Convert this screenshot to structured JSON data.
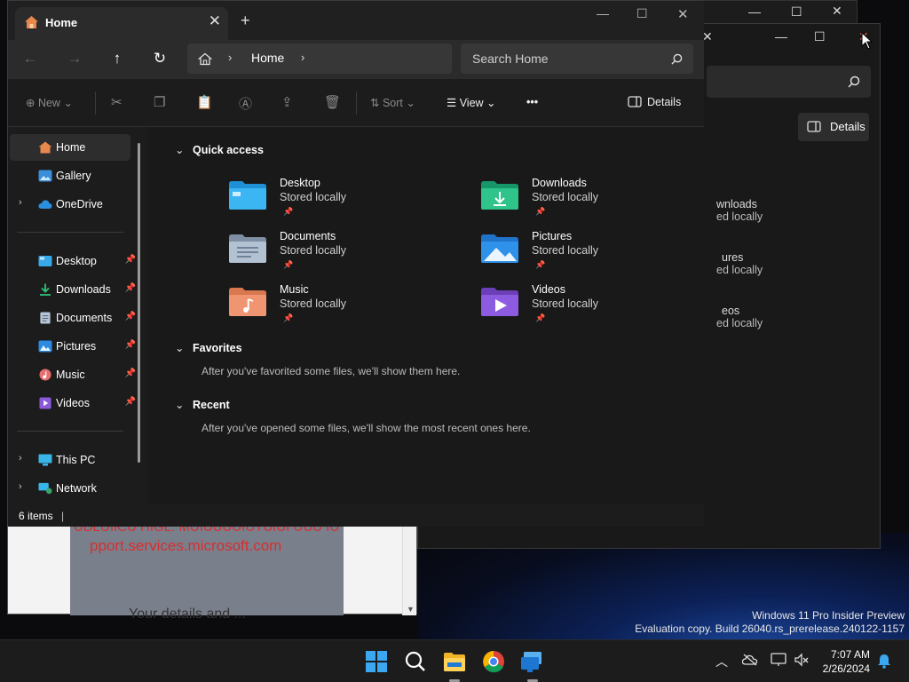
{
  "watermark": {
    "line1": "Windows 11 Pro Insider Preview",
    "line2": "Evaluation copy. Build 26040.rs_prerelease.240122-1157"
  },
  "back_browser": {
    "red_line1": "UDLUIICU HIGL. MUIUUUUIUTUIUI UUU IU",
    "red_line2": "pport.services.microsoft.com",
    "dark_text": "Your details and ..."
  },
  "win3": {
    "details_label": "Details",
    "items": [
      {
        "name": "wnloads",
        "sub": "ed locally"
      },
      {
        "name": "ures",
        "sub": "ed locally"
      },
      {
        "name": "eos",
        "sub": "ed locally"
      }
    ]
  },
  "explorer": {
    "tab_title": "Home",
    "address": "Home",
    "search_placeholder": "Search Home",
    "commands": {
      "new": "New",
      "sort": "Sort",
      "view": "View",
      "more": "•••",
      "details": "Details"
    },
    "sidebar": {
      "home": "Home",
      "gallery": "Gallery",
      "onedrive": "OneDrive",
      "pinned": [
        {
          "label": "Desktop"
        },
        {
          "label": "Downloads"
        },
        {
          "label": "Documents"
        },
        {
          "label": "Pictures"
        },
        {
          "label": "Music"
        },
        {
          "label": "Videos"
        }
      ],
      "this_pc": "This PC",
      "network": "Network"
    },
    "sections": {
      "quick_access": "Quick access",
      "favorites": "Favorites",
      "favorites_hint": "After you've favorited some files, we'll show them here.",
      "recent": "Recent",
      "recent_hint": "After you've opened some files, we'll show the most recent ones here."
    },
    "quick_access_items": [
      {
        "name": "Desktop",
        "sub": "Stored locally"
      },
      {
        "name": "Downloads",
        "sub": "Stored locally"
      },
      {
        "name": "Documents",
        "sub": "Stored locally"
      },
      {
        "name": "Pictures",
        "sub": "Stored locally"
      },
      {
        "name": "Music",
        "sub": "Stored locally"
      },
      {
        "name": "Videos",
        "sub": "Stored locally"
      }
    ],
    "status": "6 items"
  },
  "taskbar": {
    "time": "7:07 AM",
    "date": "2/26/2024"
  }
}
